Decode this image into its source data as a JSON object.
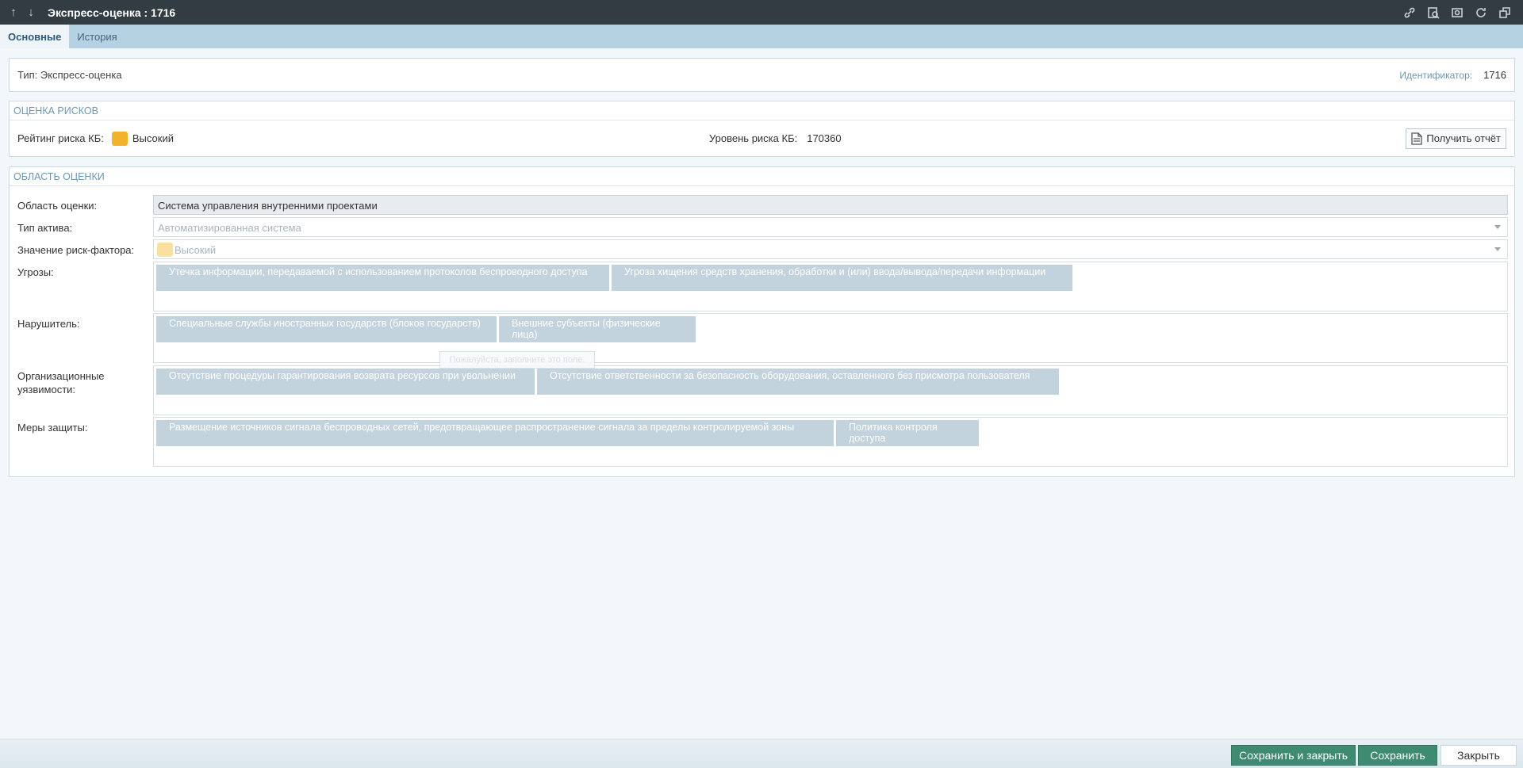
{
  "window": {
    "title": "Экспресс-оценка : 1716",
    "nav_up_icon": "arrow-up-icon",
    "nav_down_icon": "arrow-down-icon",
    "tools": [
      "link-icon",
      "search-doc-icon",
      "image-icon",
      "refresh-icon",
      "restore-window-icon"
    ]
  },
  "tabs": [
    {
      "label": "Основные",
      "active": true
    },
    {
      "label": "История",
      "active": false
    }
  ],
  "type_panel": {
    "type_text": "Тип: Экспресс-оценка",
    "id_label": "Идентификатор:",
    "id_value": "1716"
  },
  "risk_panel": {
    "header": "ОЦЕНКА РИСКОВ",
    "rating_label": "Рейтинг риска КБ:",
    "rating_value": "Высокий",
    "rating_color": "#f2b32c",
    "level_label": "Уровень риска КБ:",
    "level_value": "170360",
    "report_button": "Получить отчёт"
  },
  "scope_panel": {
    "header": "ОБЛАСТЬ ОЦЕНКИ",
    "scope_label": "Область оценки:",
    "scope_value": "Система управления внутренними проектами",
    "asset_label": "Тип актива:",
    "asset_value": "Автоматизированная система",
    "factor_label": "Значение риск-фактора:",
    "factor_value": "Высокий",
    "factor_color": "#f9dfa0",
    "threats_label": "Угрозы:",
    "threats": [
      "Утечка информации, передаваемой с использованием протоколов беспроводного доступа",
      "Угроза хищения средств хранения, обработки и (или) ввода/вывода/передачи информации"
    ],
    "violator_label": "Нарушитель:",
    "violators": [
      "Специальные службы иностранных государств (блоков государств)",
      "Внешние субъекты (физические лица)"
    ],
    "hint": "Пожалуйста, заполните это поле.",
    "vuln_label": "Организационные уязвимости:",
    "vulnerabilities": [
      "Отсутствие процедуры гарантирования возврата ресурсов при увольнении",
      "Отсутствие ответственности за безопасность оборудования, оставленного без присмотра пользователя"
    ],
    "measures_label": "Меры защиты:",
    "measures": [
      "Размещение источников сигнала беспроводных сетей, предотвращающее распространение сигнала за пределы контролируемой зоны",
      "Политика контроля доступа"
    ]
  },
  "footer": {
    "save_close": "Сохранить и закрыть",
    "save": "Сохранить",
    "close": "Закрыть"
  }
}
